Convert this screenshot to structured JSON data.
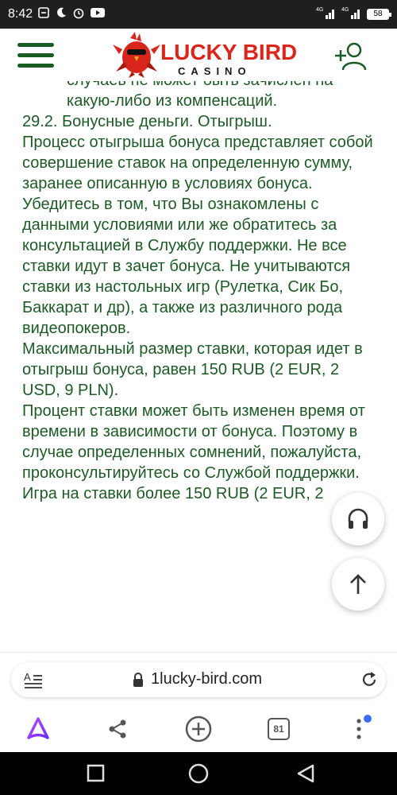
{
  "status_bar": {
    "time": "8:42",
    "battery": "58",
    "net1": "4G",
    "net2": "4G"
  },
  "header": {
    "logo_title": "LUCKY BIRD",
    "logo_sub": "CASINO"
  },
  "content": {
    "cut_line": "случаев не может быть зачислен на",
    "p0": "какую-либо из компенсаций.",
    "p1": "29.2. Бонусные деньги. Отыгрыш.",
    "p2": "Процесс отыгрыша бонуса представляет собой совершение ставок на определенную сумму, заранее описанную в условиях бонуса. Убедитесь в том, что Вы ознакомлены с данными условиями или же обратитесь за консультацией в Службу поддержки. Не все ставки идут в зачет бонуса. Не учитываются ставки из настольных игр (Рулетка, Сик Бо, Баккарат и др), а также из различного рода видеопокеров.",
    "p3": "Максимальный размер ставки, которая идет в отыгрыш бонуса, равен 150 RUB (2 EUR, 2 USD, 9 PLN).",
    "p4": "Процент ставки может быть изменен время от времени  в зависимости от бонуса. Поэтому в случае определенных сомнений, пожалуйста, проконсультируйтесь со Службой поддержки.",
    "p5": "Игра на ставки более 150 RUB (2 EUR, 2"
  },
  "browser": {
    "url": "1lucky-bird.com",
    "tab_count": "81"
  },
  "colors": {
    "text_green": "#1d5a26",
    "logo_red": "#d9261c",
    "badge_blue": "#3b6cf6"
  }
}
